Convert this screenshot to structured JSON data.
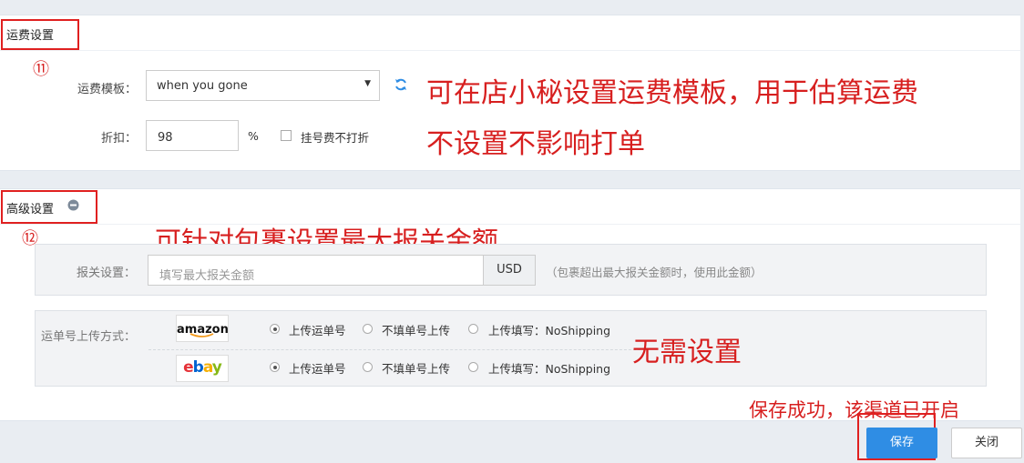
{
  "freight": {
    "title": "运费设置",
    "step_mark": "⑪",
    "template_label": "运费模板：",
    "template_value": "when you gone",
    "discount_label": "折扣：",
    "discount_value": "98",
    "percent": "%",
    "no_discount_label": "挂号费不打折",
    "anno_line1": "可在店小秘设置运费模板，用于估算运费",
    "anno_line2": "不设置不影响打单"
  },
  "advanced": {
    "title": "高级设置",
    "step_mark": "⑫",
    "anno_customs": "可针对包裹设置最大报关金额",
    "customs_label": "报关设置：",
    "customs_placeholder": "填写最大报关金额",
    "currency": "USD",
    "customs_hint": "（包裹超出最大报关金额时，使用此金额）",
    "tracking_label": "运单号上传方式：",
    "platforms": [
      {
        "logo": "amazon",
        "options": [
          "上传运单号",
          "不填单号上传",
          "上传填写：NoShipping"
        ],
        "selected": 0
      },
      {
        "logo": "ebay",
        "options": [
          "上传运单号",
          "不填单号上传",
          "上传填写：NoShipping"
        ],
        "selected": 0
      }
    ],
    "anno_no_need": "无需设置"
  },
  "footer": {
    "save_success": "保存成功，该渠道已开启",
    "save_label": "保存",
    "close_label": "关闭"
  },
  "colors": {
    "accent": "#2f8de4",
    "annotation": "#d71f1f"
  }
}
